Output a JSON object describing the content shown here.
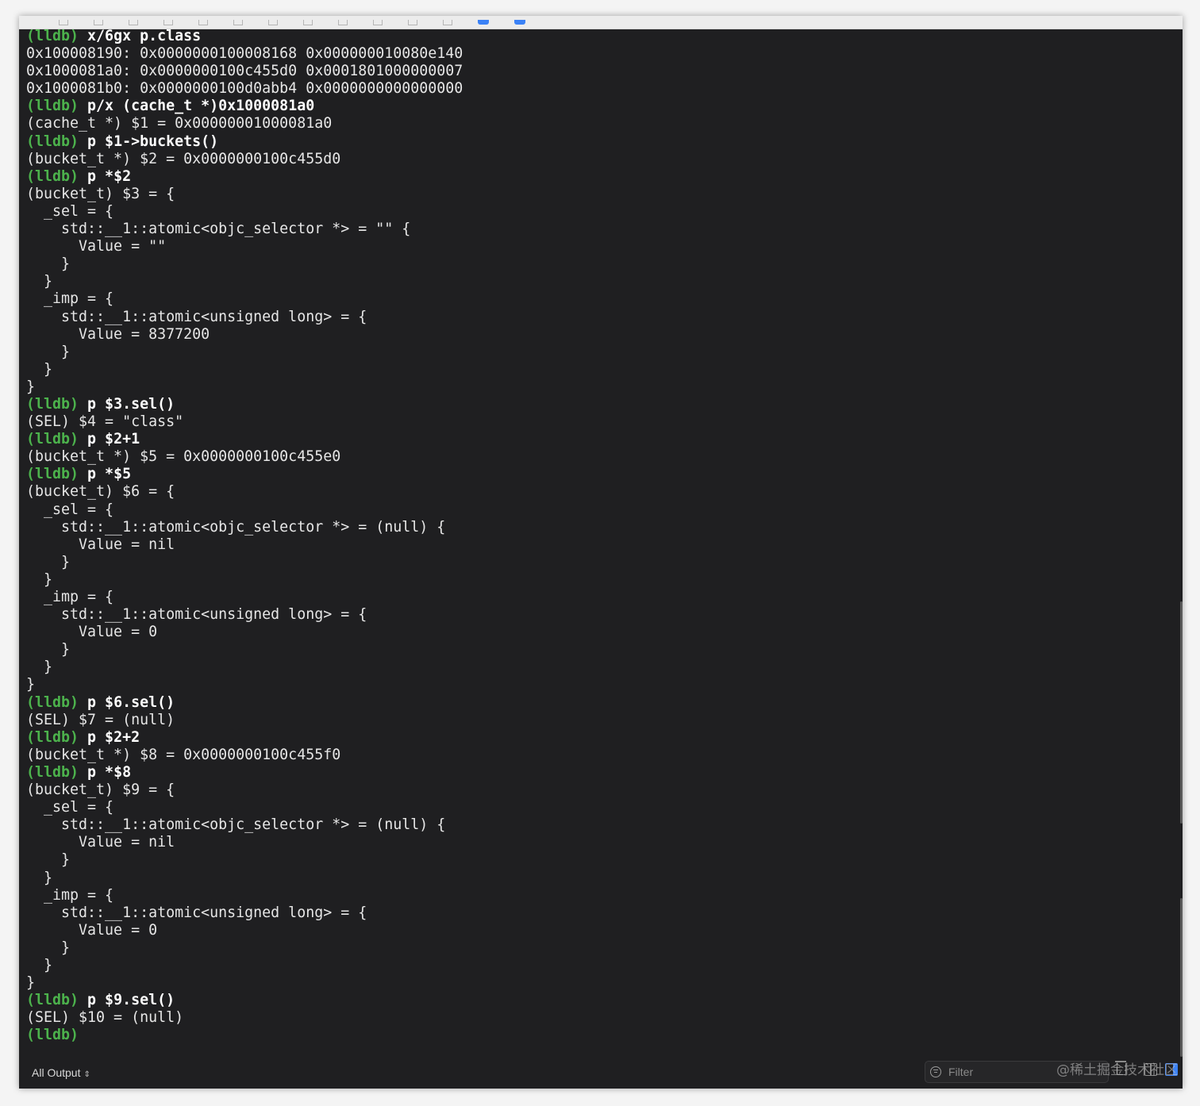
{
  "console": {
    "lines": [
      {
        "prompt": "(lldb) ",
        "cmd": "x/6gx p.class",
        "text": ""
      },
      {
        "prompt": "",
        "cmd": "",
        "text": "0x100008190: 0x0000000100008168 0x000000010080e140"
      },
      {
        "prompt": "",
        "cmd": "",
        "text": "0x1000081a0: 0x0000000100c455d0 0x0001801000000007"
      },
      {
        "prompt": "",
        "cmd": "",
        "text": "0x1000081b0: 0x0000000100d0abb4 0x0000000000000000"
      },
      {
        "prompt": "(lldb) ",
        "cmd": "p/x (cache_t *)0x1000081a0",
        "text": ""
      },
      {
        "prompt": "",
        "cmd": "",
        "text": "(cache_t *) $1 = 0x00000001000081a0"
      },
      {
        "prompt": "(lldb) ",
        "cmd": "p $1->buckets()",
        "text": ""
      },
      {
        "prompt": "",
        "cmd": "",
        "text": "(bucket_t *) $2 = 0x0000000100c455d0"
      },
      {
        "prompt": "(lldb) ",
        "cmd": "p *$2",
        "text": ""
      },
      {
        "prompt": "",
        "cmd": "",
        "text": "(bucket_t) $3 = {"
      },
      {
        "prompt": "",
        "cmd": "",
        "text": "  _sel = {"
      },
      {
        "prompt": "",
        "cmd": "",
        "text": "    std::__1::atomic<objc_selector *> = \"\" {"
      },
      {
        "prompt": "",
        "cmd": "",
        "text": "      Value = \"\""
      },
      {
        "prompt": "",
        "cmd": "",
        "text": "    }"
      },
      {
        "prompt": "",
        "cmd": "",
        "text": "  }"
      },
      {
        "prompt": "",
        "cmd": "",
        "text": "  _imp = {"
      },
      {
        "prompt": "",
        "cmd": "",
        "text": "    std::__1::atomic<unsigned long> = {"
      },
      {
        "prompt": "",
        "cmd": "",
        "text": "      Value = 8377200"
      },
      {
        "prompt": "",
        "cmd": "",
        "text": "    }"
      },
      {
        "prompt": "",
        "cmd": "",
        "text": "  }"
      },
      {
        "prompt": "",
        "cmd": "",
        "text": "}"
      },
      {
        "prompt": "(lldb) ",
        "cmd": "p $3.sel()",
        "text": ""
      },
      {
        "prompt": "",
        "cmd": "",
        "text": "(SEL) $4 = \"class\""
      },
      {
        "prompt": "(lldb) ",
        "cmd": "p $2+1",
        "text": ""
      },
      {
        "prompt": "",
        "cmd": "",
        "text": "(bucket_t *) $5 = 0x0000000100c455e0"
      },
      {
        "prompt": "(lldb) ",
        "cmd": "p *$5",
        "text": ""
      },
      {
        "prompt": "",
        "cmd": "",
        "text": "(bucket_t) $6 = {"
      },
      {
        "prompt": "",
        "cmd": "",
        "text": "  _sel = {"
      },
      {
        "prompt": "",
        "cmd": "",
        "text": "    std::__1::atomic<objc_selector *> = (null) {"
      },
      {
        "prompt": "",
        "cmd": "",
        "text": "      Value = nil"
      },
      {
        "prompt": "",
        "cmd": "",
        "text": "    }"
      },
      {
        "prompt": "",
        "cmd": "",
        "text": "  }"
      },
      {
        "prompt": "",
        "cmd": "",
        "text": "  _imp = {"
      },
      {
        "prompt": "",
        "cmd": "",
        "text": "    std::__1::atomic<unsigned long> = {"
      },
      {
        "prompt": "",
        "cmd": "",
        "text": "      Value = 0"
      },
      {
        "prompt": "",
        "cmd": "",
        "text": "    }"
      },
      {
        "prompt": "",
        "cmd": "",
        "text": "  }"
      },
      {
        "prompt": "",
        "cmd": "",
        "text": "}"
      },
      {
        "prompt": "(lldb) ",
        "cmd": "p $6.sel()",
        "text": ""
      },
      {
        "prompt": "",
        "cmd": "",
        "text": "(SEL) $7 = (null)"
      },
      {
        "prompt": "(lldb) ",
        "cmd": "p $2+2",
        "text": ""
      },
      {
        "prompt": "",
        "cmd": "",
        "text": "(bucket_t *) $8 = 0x0000000100c455f0"
      },
      {
        "prompt": "(lldb) ",
        "cmd": "p *$8",
        "text": ""
      },
      {
        "prompt": "",
        "cmd": "",
        "text": "(bucket_t) $9 = {"
      },
      {
        "prompt": "",
        "cmd": "",
        "text": "  _sel = {"
      },
      {
        "prompt": "",
        "cmd": "",
        "text": "    std::__1::atomic<objc_selector *> = (null) {"
      },
      {
        "prompt": "",
        "cmd": "",
        "text": "      Value = nil"
      },
      {
        "prompt": "",
        "cmd": "",
        "text": "    }"
      },
      {
        "prompt": "",
        "cmd": "",
        "text": "  }"
      },
      {
        "prompt": "",
        "cmd": "",
        "text": "  _imp = {"
      },
      {
        "prompt": "",
        "cmd": "",
        "text": "    std::__1::atomic<unsigned long> = {"
      },
      {
        "prompt": "",
        "cmd": "",
        "text": "      Value = 0"
      },
      {
        "prompt": "",
        "cmd": "",
        "text": "    }"
      },
      {
        "prompt": "",
        "cmd": "",
        "text": "  }"
      },
      {
        "prompt": "",
        "cmd": "",
        "text": "}"
      },
      {
        "prompt": "(lldb) ",
        "cmd": "p $9.sel()",
        "text": ""
      },
      {
        "prompt": "",
        "cmd": "",
        "text": "(SEL) $10 = (null)"
      },
      {
        "prompt": "(lldb)",
        "cmd": "",
        "text": ""
      }
    ]
  },
  "bottom_bar": {
    "output_selector": "All Output",
    "output_selector_icon": "up-down-chevron-icon",
    "filter_placeholder": "Filter",
    "filter_icon": "filter-icon",
    "trash_icon": "trash-icon",
    "split_icon": "split-view-icon",
    "panel_icon": "panel-toggle-icon"
  },
  "watermark": "@稀土掘金技术社区",
  "colors": {
    "background": "#1f1f21",
    "prompt": "#4cb24c",
    "command": "#ffffff",
    "output": "#e6e6e6",
    "accent": "#3b82f6"
  }
}
